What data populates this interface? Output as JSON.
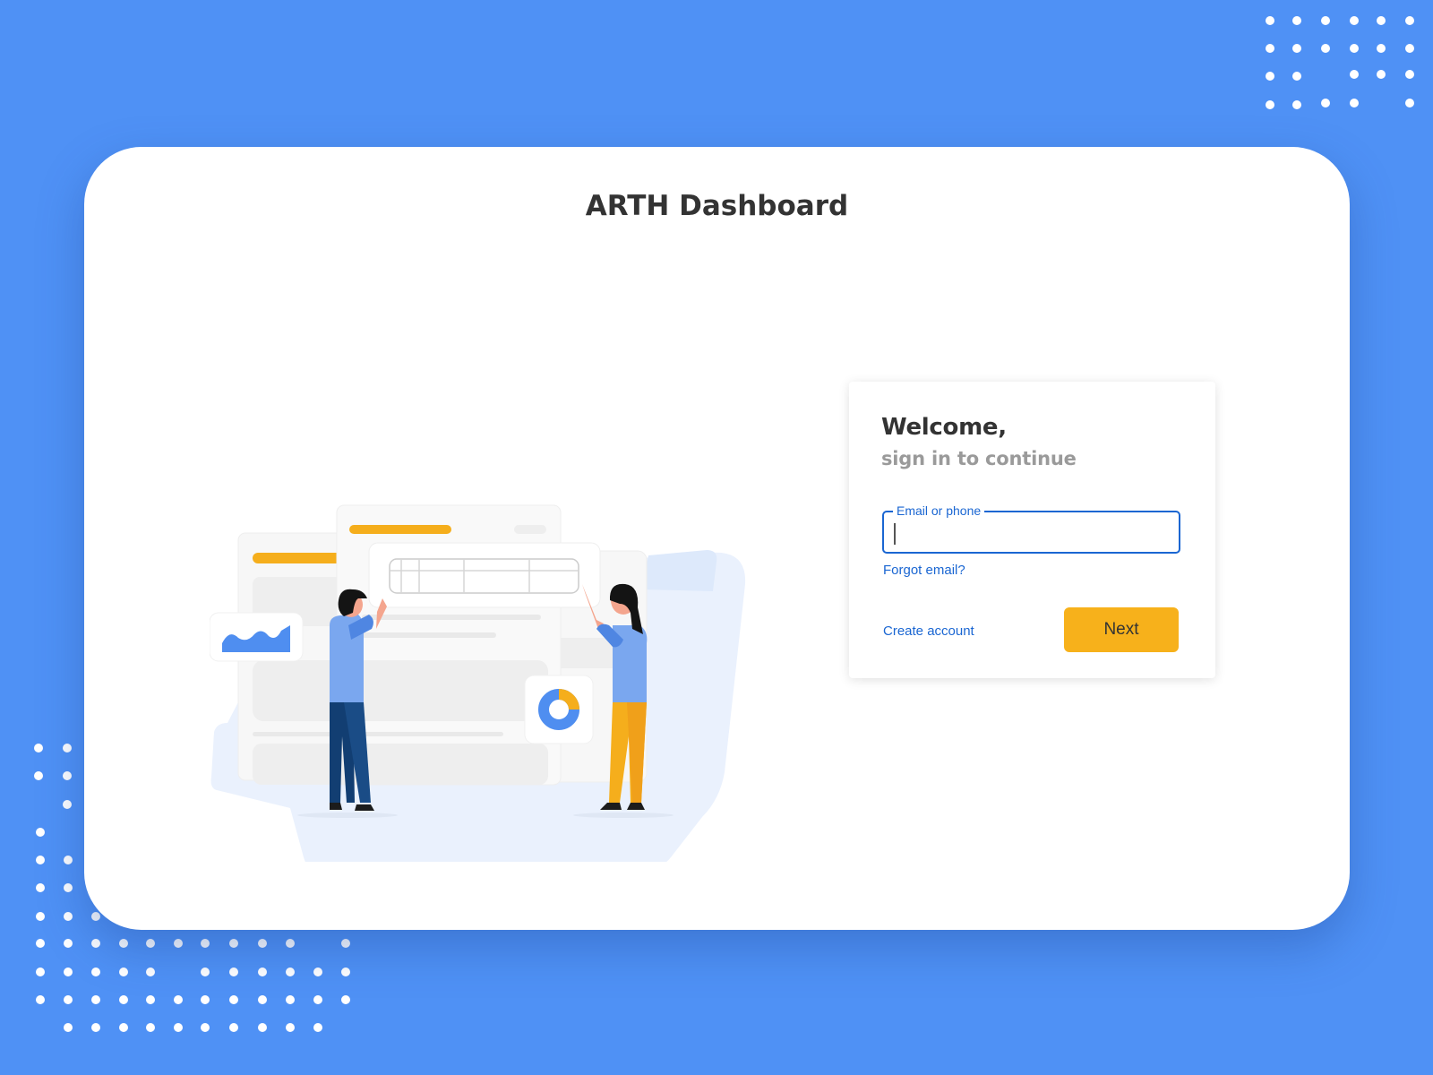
{
  "app": {
    "title": "ARTH Dashboard"
  },
  "login": {
    "welcome": "Welcome,",
    "subtitle": "sign in to continue",
    "email_label": "Email or phone",
    "email_value": "",
    "forgot_link": "Forgot email?",
    "create_link": "Create account",
    "next_button": "Next"
  },
  "colors": {
    "background": "#4f91f5",
    "card": "#ffffff",
    "accent": "#f7b11b",
    "link": "#1a66d2",
    "title_text": "#333333",
    "subtitle_text": "#9a9a9a"
  },
  "illustration": {
    "name": "dashboard-team-illustration",
    "icons": [
      "area-chart-icon",
      "donut-chart-icon",
      "table-icon"
    ]
  }
}
